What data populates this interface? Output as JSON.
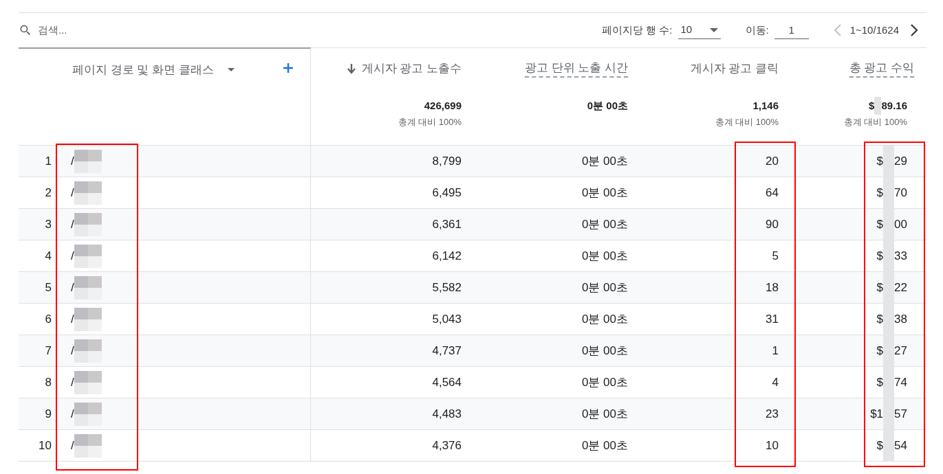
{
  "search": {
    "placeholder": "검색..."
  },
  "pagination": {
    "rows_per_page_label": "페이지당 행 수:",
    "rows_per_page": "10",
    "goto_label": "이동:",
    "goto_value": "1",
    "range": "1~10/1624",
    "prev_disabled": true,
    "next_disabled": false
  },
  "dimension": {
    "label": "페이지 경로 및 화면 클래스",
    "highlighted": true
  },
  "columns": [
    {
      "label": "게시자 광고 노출수",
      "sort_arrow": true,
      "underlined": false,
      "highlighted": false,
      "total": "426,699",
      "share": "총계 대비 100%"
    },
    {
      "label": "광고 단위 노출 시간",
      "sort_arrow": false,
      "underlined": true,
      "highlighted": false,
      "total": "0분 00초"
    },
    {
      "label": "게시자 광고 클릭",
      "sort_arrow": false,
      "underlined": false,
      "highlighted": true,
      "total": "1,146",
      "share": "총계 대비 100%"
    },
    {
      "label": "총 광고 수익",
      "sort_arrow": false,
      "underlined": true,
      "highlighted": true,
      "total_prefix": "$",
      "total_suffix": "89.16",
      "share": "총계 대비 100%"
    }
  ],
  "rows": [
    {
      "index": "1",
      "path": "/",
      "impressions": "8,799",
      "time": "0분 00초",
      "clicks": "20",
      "revenue_prefix": "$",
      "revenue_suffix": "29"
    },
    {
      "index": "2",
      "path": "/",
      "impressions": "6,495",
      "time": "0분 00초",
      "clicks": "64",
      "revenue_prefix": "$",
      "revenue_suffix": "70"
    },
    {
      "index": "3",
      "path": "/",
      "impressions": "6,361",
      "time": "0분 00초",
      "clicks": "90",
      "revenue_prefix": "$",
      "revenue_suffix": "00"
    },
    {
      "index": "4",
      "path": "/",
      "impressions": "6,142",
      "time": "0분 00초",
      "clicks": "5",
      "revenue_prefix": "$",
      "revenue_suffix": "33"
    },
    {
      "index": "5",
      "path": "/",
      "impressions": "5,582",
      "time": "0분 00초",
      "clicks": "18",
      "revenue_prefix": "$",
      "revenue_suffix": "22"
    },
    {
      "index": "6",
      "path": "/",
      "impressions": "5,043",
      "time": "0분 00초",
      "clicks": "31",
      "revenue_prefix": "$",
      "revenue_suffix": "38"
    },
    {
      "index": "7",
      "path": "/",
      "impressions": "4,737",
      "time": "0분 00초",
      "clicks": "1",
      "revenue_prefix": "$",
      "revenue_suffix": "27"
    },
    {
      "index": "8",
      "path": "/",
      "impressions": "4,564",
      "time": "0분 00초",
      "clicks": "4",
      "revenue_prefix": "$",
      "revenue_suffix": "74"
    },
    {
      "index": "9",
      "path": "/",
      "impressions": "4,483",
      "time": "0분 00초",
      "clicks": "23",
      "revenue_prefix": "$1",
      "revenue_suffix": "57"
    },
    {
      "index": "10",
      "path": "/",
      "impressions": "4,376",
      "time": "0분 00초",
      "clicks": "10",
      "revenue_prefix": "$",
      "revenue_suffix": "54"
    }
  ]
}
